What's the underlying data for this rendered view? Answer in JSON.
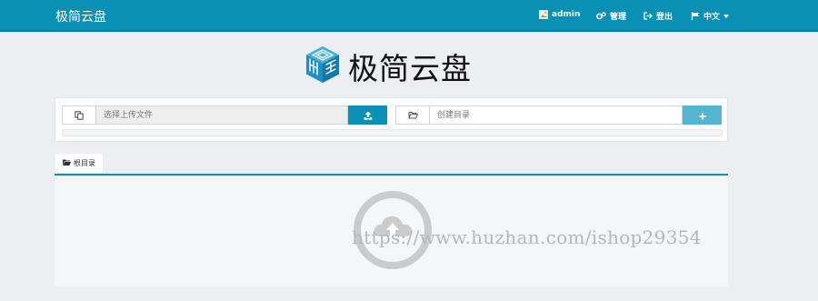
{
  "navbar": {
    "brand": "极简云盘",
    "user_label": "admin",
    "manage_label": "管理",
    "logout_label": "登出",
    "language_label": "中文"
  },
  "logo": {
    "title": "极简云盘"
  },
  "upload": {
    "file_placeholder": "选择上传文件",
    "dir_placeholder": "创建目录"
  },
  "tabs": {
    "root_label": "根目录"
  },
  "watermark": {
    "text": "https://www.huzhan.com/ishop29354"
  },
  "colors": {
    "primary": "#0a8fb5",
    "button_light": "#54b4d2",
    "background": "#eceef1"
  }
}
